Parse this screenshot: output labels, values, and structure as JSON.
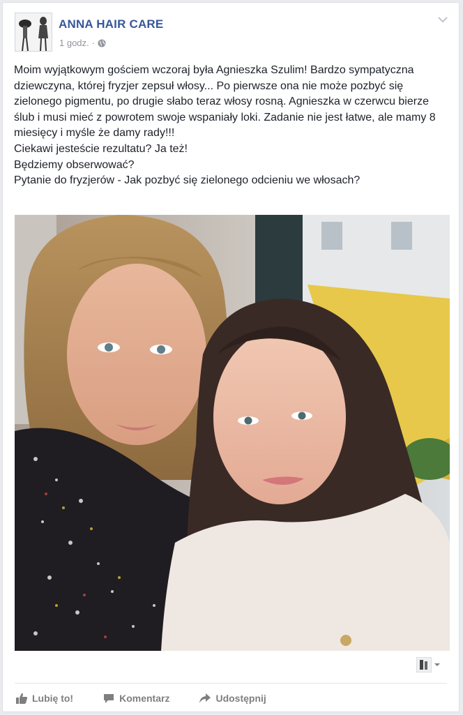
{
  "post": {
    "page_name": "ANNA HAIR CARE",
    "time": "1 godz.",
    "separator": "·",
    "text": "Moim wyjątkowym gościem wczoraj była Agnieszka Szulim! Bardzo sympatyczna dziewczyna, której fryzjer zepsuł włosy... Po pierwsze ona nie może pozbyć się zielonego pigmentu, po drugie słabo teraz włosy rosną. Agnieszka w czerwcu bierze ślub i musi mieć z powrotem swoje wspaniały loki. Zadanie nie jest łatwe, ale mamy 8 miesięcy i myśle że damy rady!!!\nCiekawi jesteście rezultatu? Ja też!\nBędziemy obserwować?\nPytanie do fryzjerów - Jak pozbyć się zielonego odcieniu we włosach?"
  },
  "actions": {
    "like": "Lubię to!",
    "comment": "Komentarz",
    "share": "Udostępnij"
  },
  "icons": {
    "privacy": "globe-icon",
    "options": "chevron-down-icon",
    "like": "thumbs-up-icon",
    "comment": "speech-bubble-icon",
    "share": "share-arrow-icon",
    "reaction": "page-avatar-dropdown-icon"
  },
  "colors": {
    "link": "#365899",
    "text": "#1d2129",
    "meta": "#90949c",
    "action": "#7f7f7f"
  }
}
